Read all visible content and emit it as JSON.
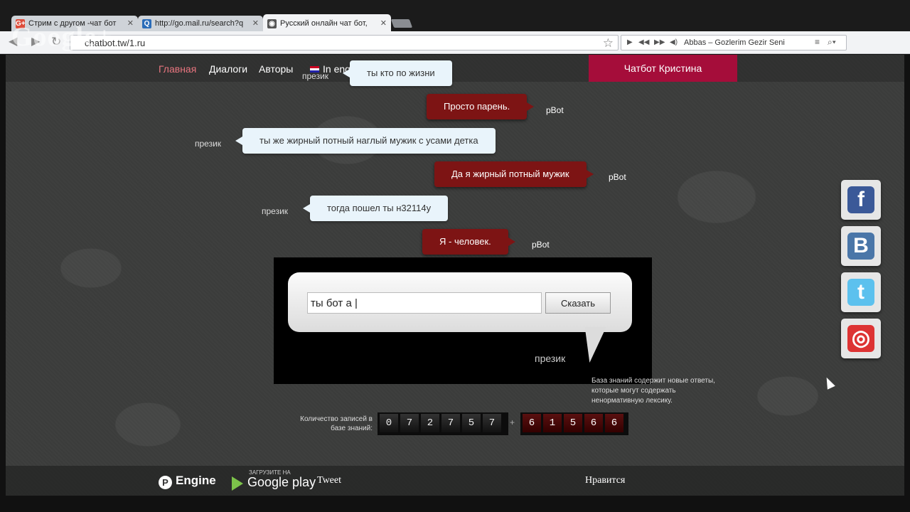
{
  "browser": {
    "tabs": [
      {
        "title": "Стрим с другом -чат бот",
        "favicon": "G+",
        "favicon_color": "#dd4b39"
      },
      {
        "title": "http://go.mail.ru/search?q",
        "favicon": "Q",
        "favicon_color": "#2b6cb8"
      },
      {
        "title": "Русский онлайн чат бот,",
        "favicon": "◉",
        "favicon_color": "#555"
      }
    ],
    "url": "chatbot.tw/1.ru",
    "overlay_logo": "Google+",
    "music": {
      "track": "Abbas – Gozlerim Gezir Seni"
    }
  },
  "nav": {
    "home": "Главная",
    "dialogs": "Диалоги",
    "authors": "Авторы",
    "english": "In english",
    "kristina": "Чатбот Кристина"
  },
  "chat": {
    "messages": [
      {
        "who": "user",
        "speaker": "презик",
        "text": "ты кто по жизни"
      },
      {
        "who": "bot",
        "speaker": "pBot",
        "text": "Просто парень."
      },
      {
        "who": "user",
        "speaker": "презик",
        "text": "ты же жирный потный наглый мужик с усами детка"
      },
      {
        "who": "bot",
        "speaker": "pBot",
        "text": "Да я жирный потный мужик"
      },
      {
        "who": "user",
        "speaker": "презик",
        "text": "тогда пошел ты н32114у"
      },
      {
        "who": "bot",
        "speaker": "pBot",
        "text": "Я - человек."
      }
    ]
  },
  "input": {
    "value": "ты бот а |",
    "button": "Сказать",
    "speaker": "презик"
  },
  "counter": {
    "notice": "База знаний содержит новые ответы, которые могут содержать ненормативную лексику.",
    "label": "Количество записей в базе знаний:",
    "digits_main": [
      "0",
      "7",
      "2",
      "7",
      "5",
      "7"
    ],
    "plus": "+",
    "digits_new": [
      "6",
      "1",
      "5",
      "6",
      "6"
    ]
  },
  "social": [
    {
      "name": "facebook",
      "glyph": "f",
      "color": "#3b5998"
    },
    {
      "name": "vkontakte",
      "glyph": "B",
      "color": "#4a76a8"
    },
    {
      "name": "twitter",
      "glyph": "t",
      "color": "#5cc1ee"
    },
    {
      "name": "chrome",
      "glyph": "◎",
      "color": "#d33"
    }
  ],
  "footer": {
    "engine": "Engine",
    "engine_logo": "P",
    "gplay_small": "ЗАГРУЗИТЕ НА",
    "gplay_big": "Google play",
    "tweet": "Tweet",
    "like": "Нравится"
  }
}
